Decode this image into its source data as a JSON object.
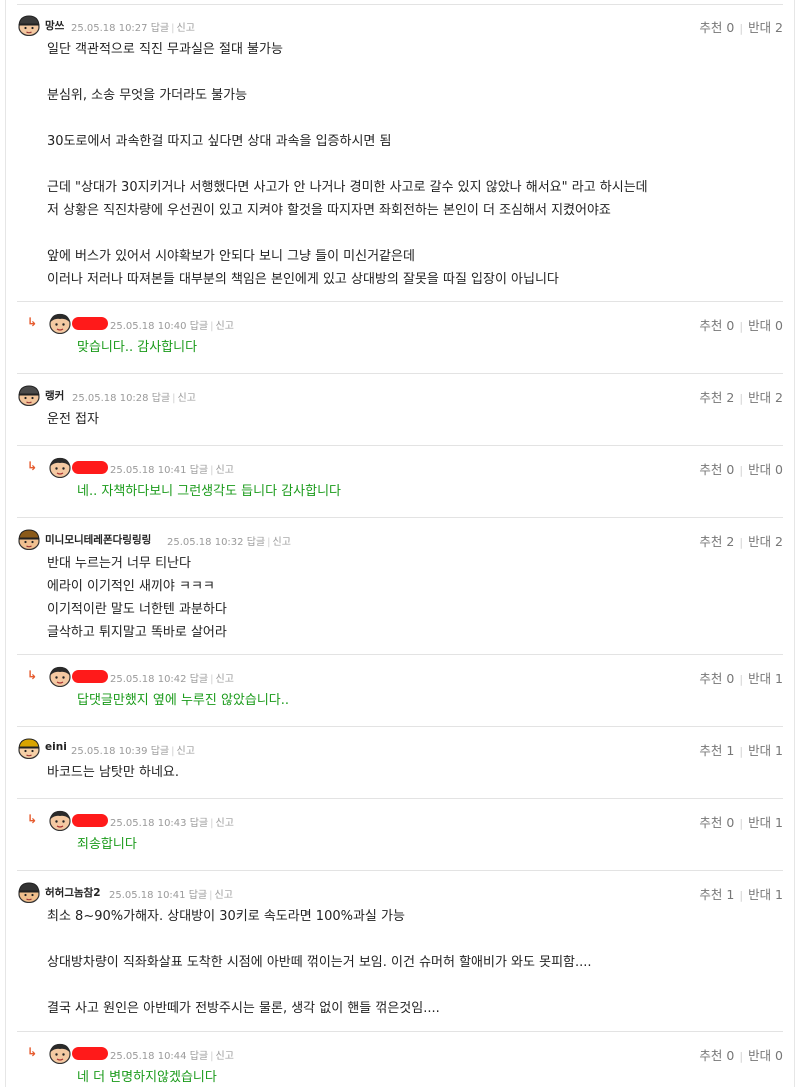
{
  "actions": {
    "reply": "답글",
    "report": "신고"
  },
  "comments": [
    {
      "nick": "망쓰",
      "time": "25.05.18 10:27",
      "up_label": "추천 0",
      "down_label": "반대 2",
      "lines": [
        "일단 객관적으로 직진 무과실은 절대 불가능",
        "",
        "분심위, 소송 무엇을 가더라도 불가능",
        "",
        "30도로에서 과속한걸 따지고 싶다면 상대 과속을 입증하시면 됨",
        "",
        "근데 \"상대가 30지키거나 서행했다면 사고가 안 나거나 경미한 사고로 갈수 있지 않았나 해서요\" 라고 하시는데",
        "저 상황은 직진차량에 우선권이 있고 지켜야 할것을 따지자면 좌회전하는 본인이 더 조심해서 지켰어야죠",
        "",
        "앞에 버스가 있어서 시야확보가 안되다 보니 그냥 들이 미신거같은데",
        "이러나 저러나 따져본들 대부분의 책임은 본인에게 있고 상대방의 잘못을 따질 입장이 아닙니다"
      ],
      "reply": {
        "time": "25.05.18 10:40",
        "up_label": "추천 0",
        "down_label": "반대 0",
        "text": "맞습니다.. 감사합니다"
      }
    },
    {
      "nick": "랭커",
      "time": "25.05.18 10:28",
      "up_label": "추천 2",
      "down_label": "반대 2",
      "lines": [
        "운전 접자"
      ],
      "reply": {
        "time": "25.05.18 10:41",
        "up_label": "추천 0",
        "down_label": "반대 0",
        "text": "네.. 자책하다보니 그런생각도 듭니다 감사합니다"
      }
    },
    {
      "nick": "미니모니테레폰다링링링",
      "time": "25.05.18 10:32",
      "up_label": "추천 2",
      "down_label": "반대 2",
      "lines": [
        "반대 누르는거 너무 티난다",
        "에라이 이기적인 새끼야 ㅋㅋㅋ",
        "이기적이란 말도 너한텐 과분하다",
        "글삭하고 튀지말고 똑바로 살어라"
      ],
      "reply": {
        "time": "25.05.18 10:42",
        "up_label": "추천 0",
        "down_label": "반대 1",
        "text": "답댓글만했지 옆에 누루진 않았습니다.."
      }
    },
    {
      "nick": "eini",
      "time": "25.05.18 10:39",
      "up_label": "추천 1",
      "down_label": "반대 1",
      "lines": [
        "바코드는 남탓만 하네요."
      ],
      "reply": {
        "time": "25.05.18 10:43",
        "up_label": "추천 0",
        "down_label": "반대 1",
        "text": "죄송합니다"
      }
    },
    {
      "nick": "허허그놈참2",
      "time": "25.05.18 10:41",
      "up_label": "추천 1",
      "down_label": "반대 1",
      "lines": [
        "최소 8~90%가해자. 상대방이 30키로 속도라면 100%과실 가능",
        "",
        "상대방차량이 직좌화살표 도착한 시점에 아반떼 꺾이는거 보임. 이건 슈머허 할애비가 와도 못피함....",
        "",
        "결국 사고 원인은 아반떼가 전방주시는 물론, 생각 없이 핸들 꺾은것임...."
      ],
      "reply": {
        "time": "25.05.18 10:44",
        "up_label": "추천 0",
        "down_label": "반대 0",
        "text": "네 더 변명하지않겠습니다"
      }
    }
  ]
}
